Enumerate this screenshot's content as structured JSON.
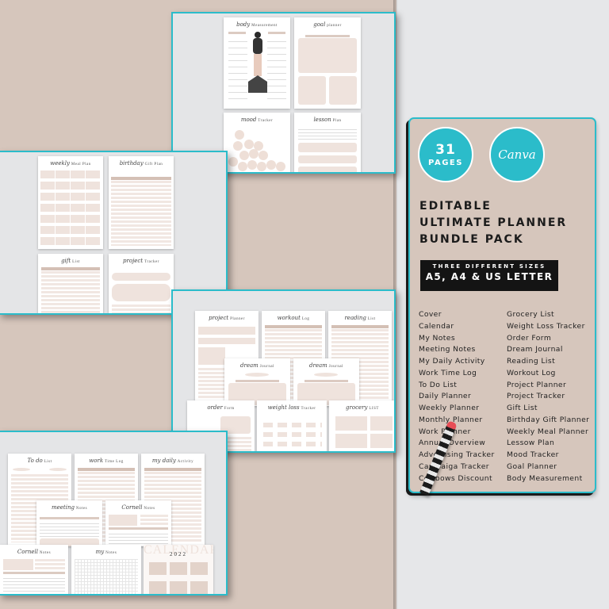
{
  "card": {
    "pages_count": "31",
    "pages_label": "PAGES",
    "canva_logo": "Canva",
    "headline": [
      "EDITABLE",
      "ULTIMATE PLANNER",
      "BUNDLE PACK"
    ],
    "sizes_subtitle": "THREE DIFFERENT SIZES",
    "sizes_title": "A5, A4 & US LETTER",
    "list_left": [
      "Cover",
      "Calendar",
      "My Notes",
      "Meeting Notes",
      "My Daily Activity",
      "Work Time Log",
      "To Do List",
      "Daily Planner",
      "Weekly Planner",
      "Monthly Planner",
      "Work Planner",
      "Annual Overview",
      "Advertising Tracker",
      "Cambaiga Tracker",
      "Cowbows Discount"
    ],
    "list_right": [
      "Grocery List",
      "Weight Loss Tracker",
      "Order Form",
      "Dream Journal",
      "Reading List",
      "Workout Log",
      "Project Planner",
      "Project Tracker",
      "Gift List",
      "Birthday Gift Planner",
      "Weekly Meal Planner",
      "Lessow Plan",
      "Mood Tracker",
      "Goal Planner",
      "Body Measurement"
    ]
  },
  "colors": {
    "accent": "#2bbcca",
    "beige": "#d6c6bc",
    "page_fill": "#efe3dd",
    "background": "#e6e7e9"
  },
  "previews": {
    "panel1": [
      {
        "script": "body",
        "plain": "Measurement"
      },
      {
        "script": "goal",
        "plain": "planner"
      },
      {
        "script": "mood",
        "plain": "Tracker"
      },
      {
        "script": "lesson",
        "plain": "Plan"
      }
    ],
    "panel2": [
      {
        "script": "weekly",
        "plain": "Meal Plan"
      },
      {
        "script": "birthday",
        "plain": "Gift Plan"
      },
      {
        "script": "gift",
        "plain": "List"
      },
      {
        "script": "project",
        "plain": "Tracker"
      }
    ],
    "panel3": [
      {
        "script": "project",
        "plain": "Planner"
      },
      {
        "script": "workout",
        "plain": "Log"
      },
      {
        "script": "reading",
        "plain": "List"
      },
      {
        "script": "dream",
        "plain": "Journal"
      },
      {
        "script": "dream",
        "plain": "Journal"
      },
      {
        "script": "order",
        "plain": "Form"
      },
      {
        "script": "weight loss",
        "plain": "Tracker"
      },
      {
        "script": "grocery",
        "plain": "LIST"
      }
    ],
    "panel4": [
      {
        "script": "To do",
        "plain": "List"
      },
      {
        "script": "work",
        "plain": "Time Log"
      },
      {
        "script": "my daily",
        "plain": "Activity"
      },
      {
        "script": "meeting",
        "plain": "Notes"
      },
      {
        "script": "Cornell",
        "plain": "Notes"
      },
      {
        "script": "Cornell",
        "plain": "Notes"
      },
      {
        "script": "my",
        "plain": "Notes"
      }
    ],
    "calendar_watermark": "CALENDAR",
    "calendar_year": "2022"
  }
}
